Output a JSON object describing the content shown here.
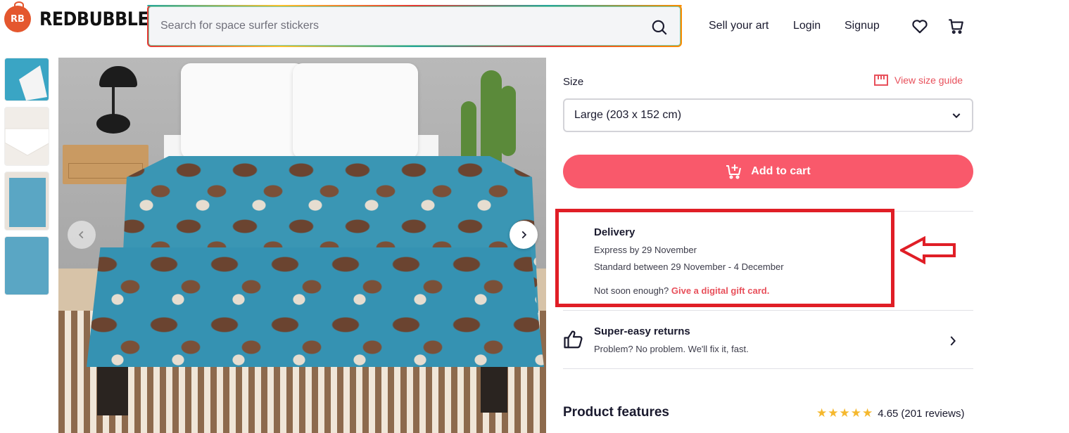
{
  "header": {
    "logo_text": "REDBUBBLE",
    "logo_badge": "RB",
    "search_placeholder": "Search for space surfer stickers",
    "nav": {
      "sell": "Sell your art",
      "login": "Login",
      "signup": "Signup"
    },
    "icons": [
      "search-icon",
      "heart-icon",
      "cart-icon"
    ]
  },
  "product": {
    "size_label": "Size",
    "size_guide_label": "View size guide",
    "selected_size": "Large (203 x 152 cm)",
    "add_to_cart_label": "Add to cart",
    "accent_color": "#f9596b"
  },
  "delivery": {
    "title": "Delivery",
    "express": "Express by 29 November",
    "standard": "Standard between 29 November - 4 December",
    "not_soon": "Not soon enough?",
    "gift_link": "Give a digital gift card."
  },
  "returns": {
    "title": "Super-easy returns",
    "subtitle": "Problem? No problem. We'll fix it, fast."
  },
  "features": {
    "title": "Product features",
    "rating": "4.65",
    "reviews": "(201 reviews)",
    "stars_count": 5
  },
  "annotation": {
    "highlight_color": "#e01e26"
  }
}
